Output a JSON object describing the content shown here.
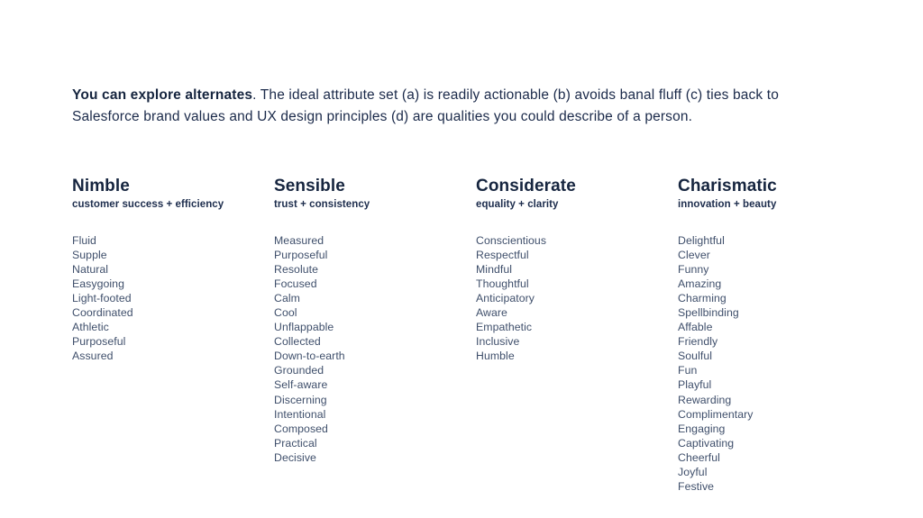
{
  "intro": {
    "lead": "You can explore alternates",
    "rest": ". The ideal attribute set (a) is readily actionable (b) avoids banal fluff (c) ties back to Salesforce brand values and UX design principles (d) are qualities you could describe of a person."
  },
  "colors": {
    "background": "#ffffff",
    "heading": "#16253f",
    "body": "#1b2a4a",
    "list_item": "#3f4f6b"
  },
  "columns": [
    {
      "title": "Nimble",
      "subtitle": "customer success + efficiency",
      "items": [
        "Fluid",
        "Supple",
        "Natural",
        "Easygoing",
        "Light-footed",
        "Coordinated",
        "Athletic",
        "Purposeful",
        "Assured"
      ]
    },
    {
      "title": "Sensible",
      "subtitle": "trust + consistency",
      "items": [
        "Measured",
        "Purposeful",
        "Resolute",
        "Focused",
        "Calm",
        "Cool",
        "Unflappable",
        "Collected",
        "Down-to-earth",
        "Grounded",
        "Self-aware",
        "Discerning",
        "Intentional",
        "Composed",
        "Practical",
        "Decisive"
      ]
    },
    {
      "title": "Considerate",
      "subtitle": "equality + clarity",
      "items": [
        "Conscientious",
        "Respectful",
        "Mindful",
        "Thoughtful",
        "Anticipatory",
        "Aware",
        "Empathetic",
        "Inclusive",
        "Humble"
      ]
    },
    {
      "title": "Charismatic",
      "subtitle": "innovation + beauty",
      "items": [
        "Delightful",
        "Clever",
        "Funny",
        "Amazing",
        "Charming",
        "Spellbinding",
        "Affable",
        "Friendly",
        "Soulful",
        "Fun",
        "Playful",
        "Rewarding",
        "Complimentary",
        "Engaging",
        "Captivating",
        "Cheerful",
        "Joyful",
        "Festive"
      ]
    }
  ]
}
